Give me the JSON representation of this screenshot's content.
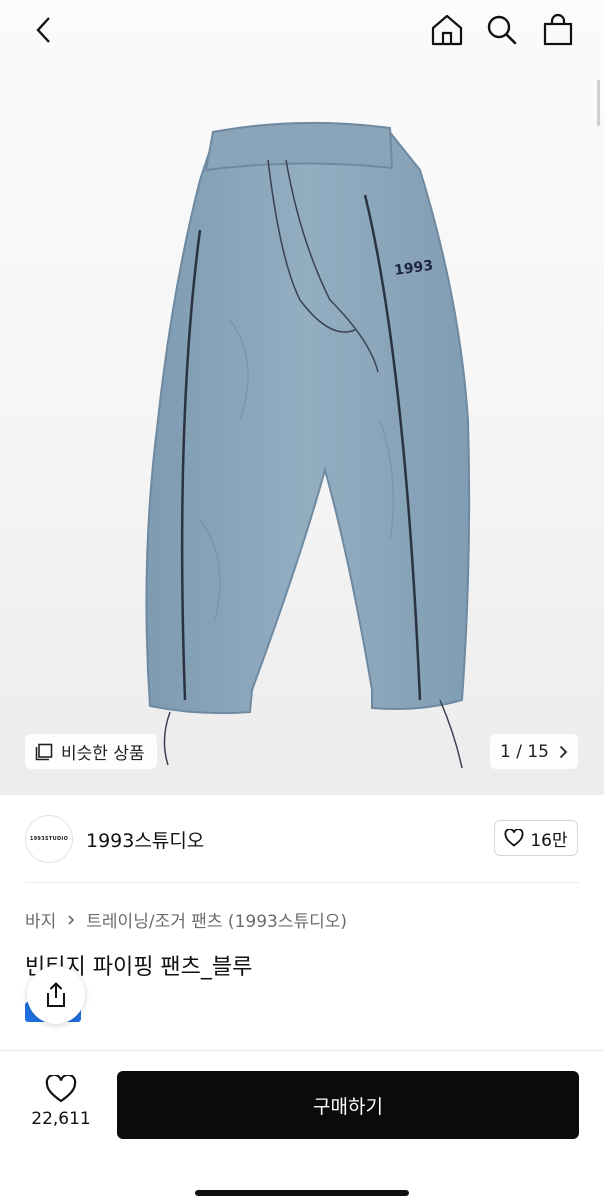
{
  "hero": {
    "similar_label": "비슷한 상품",
    "counter": "1 / 15"
  },
  "brand": {
    "logo_text": "1993STUDIO",
    "name": "1993스튜디오",
    "likes": "16만"
  },
  "breadcrumb": {
    "category": "바지",
    "subcategory": "트레이닝/조거 팬츠 (1993스튜디오)"
  },
  "product": {
    "title": "빈티지 파이핑 팬츠_블루",
    "color": "#8fa9bd",
    "accent": "#1f6fe0"
  },
  "bottom": {
    "wish_count": "22,611",
    "buy_label": "구매하기"
  },
  "icons": [
    "back-icon",
    "home-icon",
    "search-icon",
    "shopping-bag-icon",
    "similar-items-icon",
    "chevron-right-icon",
    "heart-icon",
    "share-icon"
  ]
}
